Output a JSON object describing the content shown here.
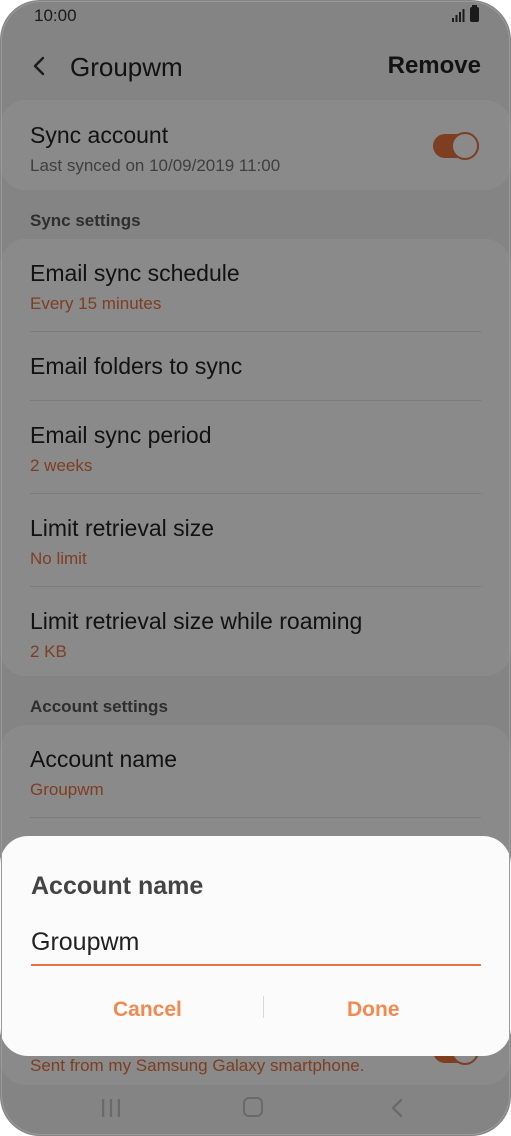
{
  "status_bar": {
    "time": "10:00"
  },
  "header": {
    "title": "Groupwm",
    "action": "Remove"
  },
  "sync_account": {
    "label": "Sync account",
    "last_synced": "Last synced on 10/09/2019  11:00",
    "enabled": true
  },
  "sections": {
    "sync_settings": "Sync settings",
    "account_settings": "Account settings"
  },
  "sync_settings": [
    {
      "label": "Email sync schedule",
      "value": "Every 15 minutes"
    },
    {
      "label": "Email folders to sync"
    },
    {
      "label": "Email sync period",
      "value": "2 weeks"
    },
    {
      "label": "Limit retrieval size",
      "value": "No limit"
    },
    {
      "label": "Limit retrieval size while roaming",
      "value": "2 KB"
    }
  ],
  "account_settings": [
    {
      "label": "Account name",
      "value": "Groupwm"
    },
    {
      "value": "Sent from my Samsung Galaxy smartphone."
    }
  ],
  "dialog": {
    "title": "Account name",
    "input_value": "Groupwm",
    "cancel": "Cancel",
    "done": "Done"
  },
  "colors": {
    "accent": "#e8733e"
  }
}
